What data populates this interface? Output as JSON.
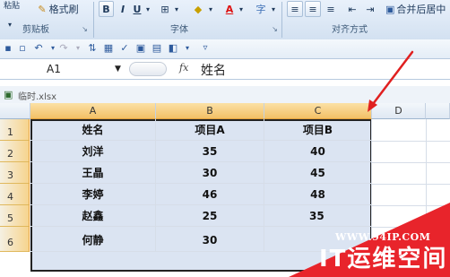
{
  "ribbon": {
    "format_painter_label": "格式刷",
    "top_left_label": "粘贴",
    "bold": "B",
    "italic": "I",
    "underline": "U",
    "merge_center_label": "合并后居中",
    "group_clipboard": "剪贴板",
    "group_font": "字体",
    "group_alignment": "对齐方式"
  },
  "formula_bar": {
    "name_box": "A1",
    "fx": "fx",
    "content": "姓名"
  },
  "workbook": {
    "title": "临时.xlsx"
  },
  "grid": {
    "columns": [
      "A",
      "B",
      "C",
      "D"
    ],
    "rows": [
      "1",
      "2",
      "3",
      "4",
      "5",
      "6"
    ],
    "cells": [
      [
        "姓名",
        "项目A",
        "项目B"
      ],
      [
        "刘洋",
        "35",
        "40"
      ],
      [
        "王晶",
        "30",
        "45"
      ],
      [
        "李婷",
        "46",
        "48"
      ],
      [
        "赵鑫",
        "25",
        "35"
      ],
      [
        "何静",
        "30",
        ""
      ]
    ]
  },
  "watermark": {
    "url": "WWW.94IP.COM",
    "brand": "IT运维空间",
    "color": "#e8242b"
  },
  "colors": {
    "selection_fill": "#becde8",
    "header_selected": "#f3c066",
    "arrow": "#e02020"
  }
}
